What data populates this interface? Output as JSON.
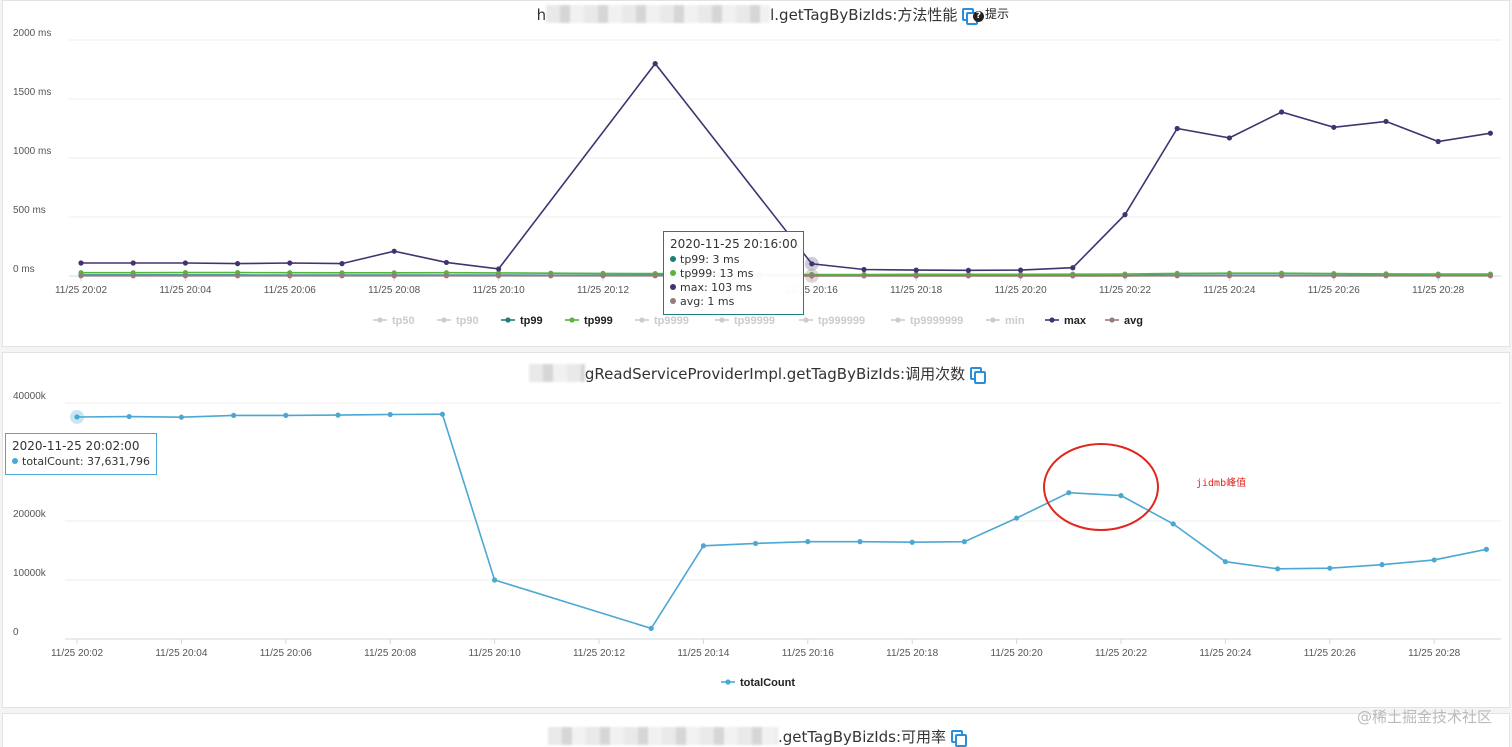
{
  "panel1": {
    "title_prefix": "h",
    "title_suffix": "l.getTagByBizIds:方法性能",
    "hint_label": "提示",
    "tooltip": {
      "time": "2020-11-25 20:16:00",
      "rows": [
        {
          "label": "tp99: 3 ms",
          "color": "#1e7e7e"
        },
        {
          "label": "tp999: 13 ms",
          "color": "#59b341"
        },
        {
          "label": "max: 103 ms",
          "color": "#3f3470"
        },
        {
          "label": "avg: 1 ms",
          "color": "#9a7a7a"
        }
      ]
    }
  },
  "panel2": {
    "title_suffix": "gReadServiceProviderImpl.getTagByBizIds:调用次数",
    "tooltip": {
      "time": "2020-11-25 20:02:00",
      "rows": [
        {
          "label": "totalCount: 37,631,796",
          "color": "#4ba8d3"
        }
      ]
    },
    "annotation": "jidmb峰值"
  },
  "panel3": {
    "title_suffix": ".getTagByBizIds:可用率"
  },
  "watermark": "@稀土掘金技术社区",
  "chart_data": [
    {
      "type": "line",
      "title": "getTagByBizIds:方法性能",
      "x": [
        "11/25 20:02",
        "11/25 20:03",
        "11/25 20:04",
        "11/25 20:05",
        "11/25 20:06",
        "11/25 20:07",
        "11/25 20:08",
        "11/25 20:09",
        "11/25 20:10",
        "11/25 20:11",
        "11/25 20:12",
        "11/25 20:13",
        "11/25 20:14",
        "11/25 20:15",
        "11/25 20:16",
        "11/25 20:17",
        "11/25 20:18",
        "11/25 20:19",
        "11/25 20:20",
        "11/25 20:21",
        "11/25 20:22",
        "11/25 20:23",
        "11/25 20:24",
        "11/25 20:25",
        "11/25 20:26",
        "11/25 20:27",
        "11/25 20:28",
        "11/25 20:29"
      ],
      "x_tick_labels": [
        "11/25 20:02",
        "11/25 20:04",
        "11/25 20:06",
        "11/25 20:08",
        "11/25 20:10",
        "11/25 20:12",
        "11/25 20:14",
        "11/25 20:16",
        "11/25 20:18",
        "11/25 20:20",
        "11/25 20:22",
        "11/25 20:24",
        "11/25 20:26",
        "11/25 20:28"
      ],
      "y_tick_labels": [
        "0 ms",
        "500 ms",
        "1000 ms",
        "1500 ms",
        "2000 ms"
      ],
      "ylim": [
        0,
        2000
      ],
      "grid": true,
      "legend_position": "bottom",
      "series": [
        {
          "name": "tp50",
          "color": "#cccccc",
          "active": false,
          "values": []
        },
        {
          "name": "tp90",
          "color": "#cccccc",
          "active": false,
          "values": []
        },
        {
          "name": "tp99",
          "color": "#1e7e7e",
          "active": true,
          "values": [
            8,
            8,
            8,
            8,
            7,
            7,
            7,
            7,
            7,
            6,
            6,
            6,
            5,
            4,
            3,
            4,
            4,
            4,
            4,
            4,
            4,
            6,
            6,
            6,
            5,
            5,
            5,
            5
          ]
        },
        {
          "name": "tp999",
          "color": "#59b341",
          "active": true,
          "values": [
            28,
            28,
            29,
            29,
            28,
            27,
            27,
            28,
            26,
            24,
            22,
            20,
            18,
            16,
            13,
            13,
            14,
            14,
            14,
            15,
            16,
            22,
            24,
            24,
            20,
            18,
            16,
            16
          ]
        },
        {
          "name": "tp9999",
          "color": "#cccccc",
          "active": false,
          "values": []
        },
        {
          "name": "tp99999",
          "color": "#cccccc",
          "active": false,
          "values": []
        },
        {
          "name": "tp999999",
          "color": "#cccccc",
          "active": false,
          "values": []
        },
        {
          "name": "tp9999999",
          "color": "#cccccc",
          "active": false,
          "values": []
        },
        {
          "name": "min",
          "color": "#cccccc",
          "active": false,
          "values": []
        },
        {
          "name": "max",
          "color": "#3f3470",
          "active": true,
          "values": [
            110,
            110,
            110,
            105,
            110,
            105,
            210,
            115,
            60,
            null,
            null,
            1800,
            null,
            null,
            103,
            55,
            50,
            48,
            50,
            70,
            520,
            1250,
            1170,
            1390,
            1260,
            1310,
            1140,
            1210
          ]
        },
        {
          "name": "avg",
          "color": "#9a7a7a",
          "active": true,
          "values": [
            2,
            2,
            2,
            2,
            2,
            2,
            2,
            2,
            2,
            2,
            2,
            2,
            2,
            1,
            1,
            1,
            1,
            1,
            1,
            1,
            1,
            2,
            2,
            2,
            2,
            2,
            2,
            2
          ]
        }
      ]
    },
    {
      "type": "line",
      "title": "getTagByBizIds:调用次数",
      "x": [
        "11/25 20:02",
        "11/25 20:03",
        "11/25 20:04",
        "11/25 20:05",
        "11/25 20:06",
        "11/25 20:07",
        "11/25 20:08",
        "11/25 20:09",
        "11/25 20:10",
        "11/25 20:13",
        "11/25 20:14",
        "11/25 20:15",
        "11/25 20:16",
        "11/25 20:17",
        "11/25 20:18",
        "11/25 20:19",
        "11/25 20:20",
        "11/25 20:21",
        "11/25 20:22",
        "11/25 20:23",
        "11/25 20:24",
        "11/25 20:25",
        "11/25 20:26",
        "11/25 20:27",
        "11/25 20:28",
        "11/25 20:29"
      ],
      "x_tick_labels": [
        "11/25 20:02",
        "11/25 20:04",
        "11/25 20:06",
        "11/25 20:08",
        "11/25 20:10",
        "11/25 20:12",
        "11/25 20:14",
        "11/25 20:16",
        "11/25 20:18",
        "11/25 20:20",
        "11/25 20:22",
        "11/25 20:24",
        "11/25 20:26",
        "11/25 20:28"
      ],
      "y_tick_labels": [
        "0",
        "10000k",
        "20000k",
        "40000k"
      ],
      "ylim": [
        0,
        40000
      ],
      "grid": true,
      "legend_position": "bottom",
      "series": [
        {
          "name": "totalCount",
          "color": "#4ba8d3",
          "active": true,
          "values": [
            37632,
            37700,
            37600,
            37900,
            37900,
            37950,
            38050,
            38100,
            10000,
            1800,
            15800,
            16200,
            16500,
            16500,
            16400,
            16500,
            20500,
            24800,
            24300,
            19500,
            13100,
            11900,
            12000,
            12600,
            13400,
            15200
          ]
        }
      ]
    }
  ]
}
